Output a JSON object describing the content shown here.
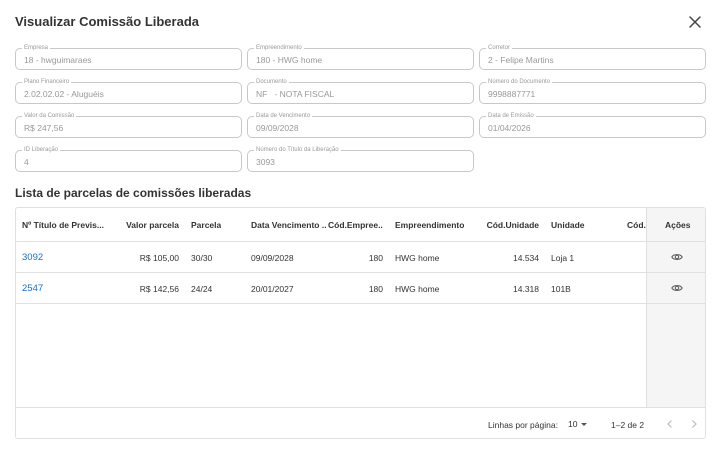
{
  "dialog": {
    "title": "Visualizar Comissão Liberada",
    "close_icon": "close-icon"
  },
  "fields": [
    {
      "label": "Empresa",
      "value": "18 - hwguimaraes"
    },
    {
      "label": "Empreendimento",
      "value": "180 - HWG home"
    },
    {
      "label": "Corretor",
      "value": "2 - Felipe Martins"
    },
    {
      "label": "Plano Financeiro",
      "value": "2.02.02.02 - Aluguéis"
    },
    {
      "label": "Documento",
      "value": "NF   - NOTA FISCAL"
    },
    {
      "label": "Número do Documento",
      "value": "9998887771"
    },
    {
      "label": "Valor da Comissão",
      "value": "R$ 247,56"
    },
    {
      "label": "Data de Vencimento",
      "value": "09/09/2028"
    },
    {
      "label": "Data de Emissão",
      "value": "01/04/2026"
    },
    {
      "label": "ID Liberação",
      "value": "4"
    },
    {
      "label": "Número do Título da Liberação",
      "value": "3093"
    }
  ],
  "list": {
    "title": "Lista de parcelas de comissões liberadas",
    "columns": [
      "Nº Título de Previs...",
      "Valor parcela",
      "Parcela",
      "Data Vencimento ...",
      "Cód.Empree...",
      "Empreendimento",
      "Cód.Unidade",
      "Unidade",
      "Cód.C",
      "Ações"
    ],
    "rows": [
      {
        "titulo": "3092",
        "valor": "R$ 105,00",
        "parcela": "30/30",
        "vencimento": "09/09/2028",
        "cod_empreend": "180",
        "empreendimento": "HWG home",
        "cod_unidade": "14.534",
        "unidade": "Loja 1"
      },
      {
        "titulo": "2547",
        "valor": "R$ 142,56",
        "parcela": "24/24",
        "vencimento": "20/01/2027",
        "cod_empreend": "180",
        "empreendimento": "HWG home",
        "cod_unidade": "14.318",
        "unidade": "101B"
      }
    ],
    "action_icon": "eye-icon"
  },
  "pagination": {
    "rows_per_page_label": "Linhas por página:",
    "rows_per_page_value": "10",
    "range": "1–2 de 2"
  }
}
